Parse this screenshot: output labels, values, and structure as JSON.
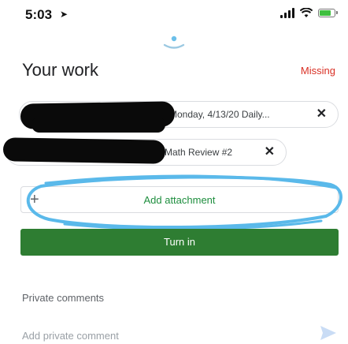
{
  "status_bar": {
    "time": "5:03",
    "location_icon": "location-arrow-icon",
    "signal_icon": "cellular-signal-icon",
    "wifi_icon": "wifi-icon",
    "battery_icon": "battery-icon"
  },
  "header": {
    "title": "Your work",
    "status": "Missing"
  },
  "attachments": [
    {
      "label": "Monday, 4/13/20 Daily...",
      "close": "✕"
    },
    {
      "label": "Math Review #2",
      "close": "✕"
    }
  ],
  "actions": {
    "add_attachment_plus": "+",
    "add_attachment_label": "Add attachment",
    "turn_in_label": "Turn in"
  },
  "comments": {
    "title": "Private comments",
    "placeholder": "Add private comment"
  },
  "colors": {
    "missing": "#d93025",
    "turn_in": "#2e7d32",
    "add_attachment_text": "#1e8e3e",
    "highlight_stroke": "#5ab9ea",
    "handle": "#8fc8e8"
  }
}
